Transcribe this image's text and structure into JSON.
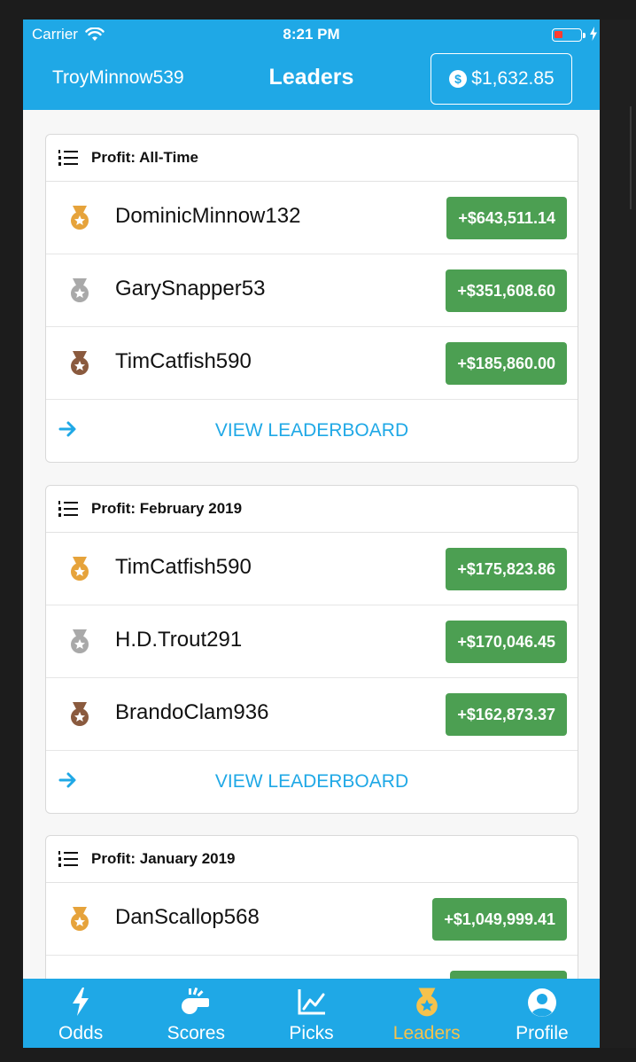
{
  "status": {
    "carrier": "Carrier",
    "time": "8:21 PM"
  },
  "header": {
    "username": "TroyMinnow539",
    "title": "Leaders",
    "balance": "$1,632.85"
  },
  "leaderboards": [
    {
      "title": "Profit: All-Time",
      "rows": [
        {
          "name": "DominicMinnow132",
          "amount": "+$643,511.14",
          "medal": "gold"
        },
        {
          "name": "GarySnapper53",
          "amount": "+$351,608.60",
          "medal": "silver"
        },
        {
          "name": "TimCatfish590",
          "amount": "+$185,860.00",
          "medal": "bronze"
        }
      ],
      "view_label": "VIEW LEADERBOARD"
    },
    {
      "title": "Profit: February 2019",
      "rows": [
        {
          "name": "TimCatfish590",
          "amount": "+$175,823.86",
          "medal": "gold"
        },
        {
          "name": "H.D.Trout291",
          "amount": "+$170,046.45",
          "medal": "silver"
        },
        {
          "name": "BrandoClam936",
          "amount": "+$162,873.37",
          "medal": "bronze"
        }
      ],
      "view_label": "VIEW LEADERBOARD"
    },
    {
      "title": "Profit: January 2019",
      "rows": [
        {
          "name": "DanScallop568",
          "amount": "+$1,049,999.41",
          "medal": "gold"
        }
      ]
    }
  ],
  "tabs": [
    {
      "label": "Odds",
      "icon": "bolt-icon"
    },
    {
      "label": "Scores",
      "icon": "whistle-icon"
    },
    {
      "label": "Picks",
      "icon": "chart-line-icon"
    },
    {
      "label": "Leaders",
      "icon": "medal-icon",
      "active": true
    },
    {
      "label": "Profile",
      "icon": "user-circle-icon"
    }
  ],
  "colors": {
    "primary": "#1fa8e6",
    "amount_green": "#4c9f52",
    "gold": "#e6a33b",
    "silver": "#a9a9a9",
    "bronze": "#8a5a3e",
    "active_tab": "#f6c24c"
  }
}
